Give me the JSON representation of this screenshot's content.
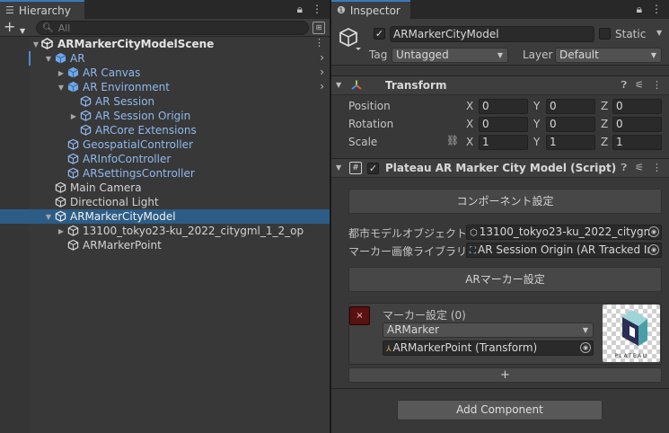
{
  "hierarchy": {
    "tab_title": "Hierarchy",
    "search_placeholder": "All",
    "scene": "ARMarkerCityModelScene",
    "items": [
      {
        "label": "AR",
        "kind": "prefab",
        "expanded": true
      },
      {
        "label": "AR Canvas",
        "kind": "prefab",
        "expanded": false
      },
      {
        "label": "AR Environment",
        "kind": "prefab",
        "expanded": true
      },
      {
        "label": "AR Session",
        "kind": "prefab"
      },
      {
        "label": "AR Session Origin",
        "kind": "prefab",
        "expanded": false
      },
      {
        "label": "ARCore Extensions",
        "kind": "prefab"
      },
      {
        "label": "GeospatialController",
        "kind": "prefab"
      },
      {
        "label": "ARInfoController",
        "kind": "prefab"
      },
      {
        "label": "ARSettingsController",
        "kind": "prefab"
      },
      {
        "label": "Main Camera",
        "kind": "object"
      },
      {
        "label": "Directional Light",
        "kind": "object"
      },
      {
        "label": "ARMarkerCityModel",
        "kind": "object",
        "expanded": true,
        "selected": true
      },
      {
        "label": "13100_tokyo23-ku_2022_citygml_1_2_op",
        "kind": "object",
        "expanded": false
      },
      {
        "label": "ARMarkerPoint",
        "kind": "object"
      }
    ]
  },
  "inspector": {
    "tab_title": "Inspector",
    "object_name": "ARMarkerCityModel",
    "active": true,
    "static_label": "Static",
    "static": false,
    "tag_label": "Tag",
    "tag_value": "Untagged",
    "layer_label": "Layer",
    "layer_value": "Default",
    "transform": {
      "title": "Transform",
      "position_label": "Position",
      "rotation_label": "Rotation",
      "scale_label": "Scale",
      "axes": [
        "X",
        "Y",
        "Z"
      ],
      "position": [
        "0",
        "0",
        "0"
      ],
      "rotation": [
        "0",
        "0",
        "0"
      ],
      "scale": [
        "1",
        "1",
        "1"
      ]
    },
    "script": {
      "title": "Plateau AR Marker City Model (Script)",
      "enabled": true,
      "section_components": "コンポーネント設定",
      "city_model_label": "都市モデルオブジェクト",
      "city_model_value": "13100_tokyo23-ku_2022_citygm",
      "marker_lib_label": "マーカー画像ライブラリ",
      "marker_lib_value": "AR Session Origin (AR Tracked Im",
      "section_marker": "ARマーカー設定",
      "list_header": "マーカー設定 (0)",
      "marker_value": "ARMarker",
      "marker_point_value": "ARMarkerPoint (Transform)",
      "remove_label": "×",
      "add_element_label": "+",
      "thumbnail_text": "PLATEAU"
    },
    "add_component_label": "Add Component"
  },
  "colors": {
    "selection": "#2c5d87",
    "prefab_text": "#8fb8ef",
    "prefab_icon": "#6fa8e8",
    "remove_button": "#5a1111"
  }
}
